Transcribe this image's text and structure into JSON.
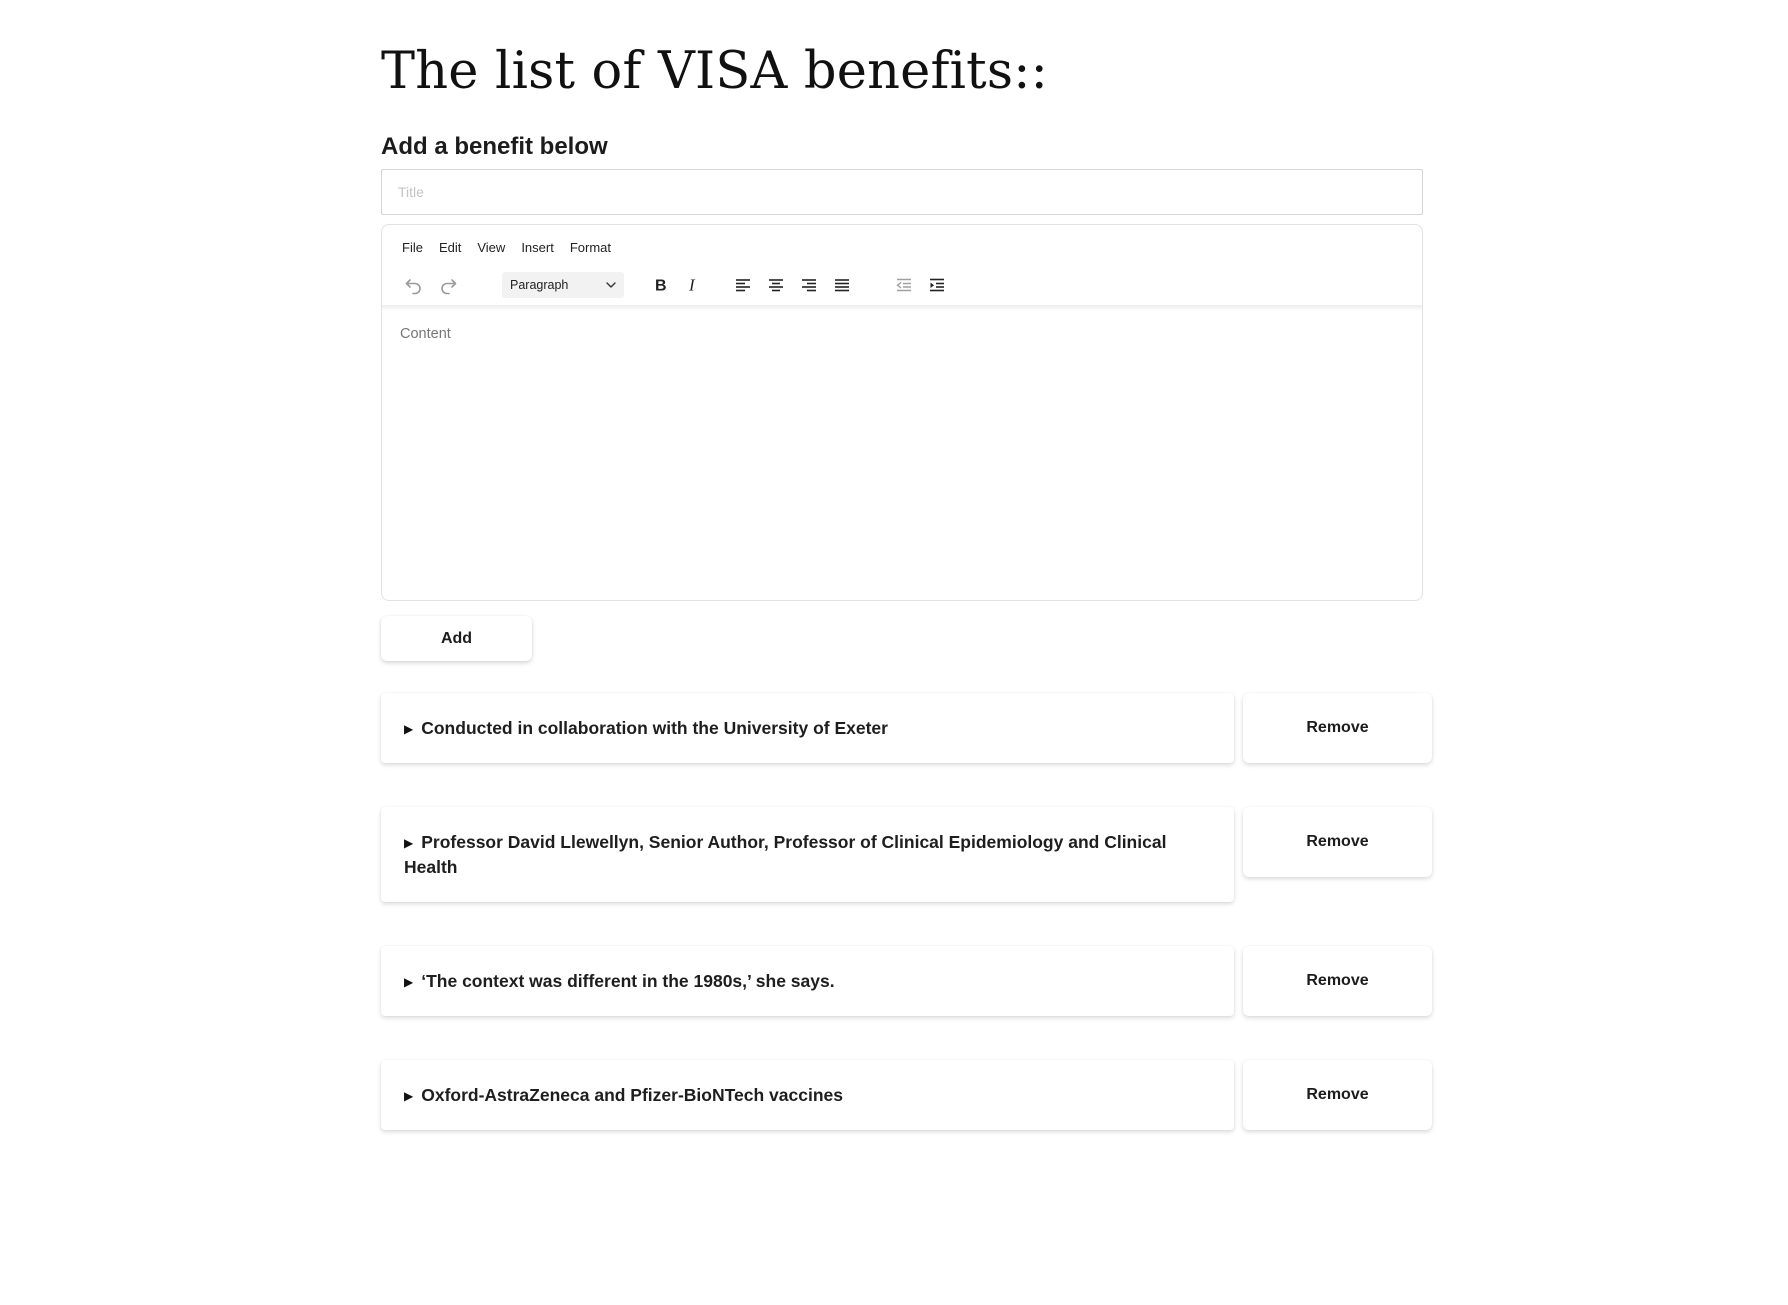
{
  "page": {
    "title": "The list of VISA benefits::",
    "subheading": "Add a benefit below"
  },
  "title_input": {
    "placeholder": "Title",
    "value": ""
  },
  "editor": {
    "menu": [
      "File",
      "Edit",
      "View",
      "Insert",
      "Format"
    ],
    "toolbar": {
      "undo_icon": "undo-icon",
      "redo_icon": "redo-icon",
      "block_format": "Paragraph",
      "bold_icon": "bold-icon",
      "italic_icon": "italic-icon",
      "align_icons": [
        "align-left-icon",
        "align-center-icon",
        "align-right-icon",
        "align-justify-icon"
      ],
      "indent_icons": [
        "outdent-icon",
        "indent-icon"
      ]
    },
    "content_placeholder": "Content"
  },
  "add_button_label": "Add",
  "benefits": [
    {
      "summary": "Conducted in collaboration with the University of Exeter",
      "remove_label": "Remove"
    },
    {
      "summary": "Professor David Llewellyn, Senior Author, Professor of Clinical Epidemiology and Clinical Health",
      "remove_label": "Remove"
    },
    {
      "summary": "‘The context was different in the 1980s,’ she says.",
      "remove_label": "Remove"
    },
    {
      "summary": "Oxford-AstraZeneca and Pfizer-BioNTech vaccines",
      "remove_label": "Remove"
    }
  ],
  "colors": {
    "text": "#1c1c1c",
    "border": "#d6d6d6",
    "placeholder": "#c4c4c4"
  }
}
